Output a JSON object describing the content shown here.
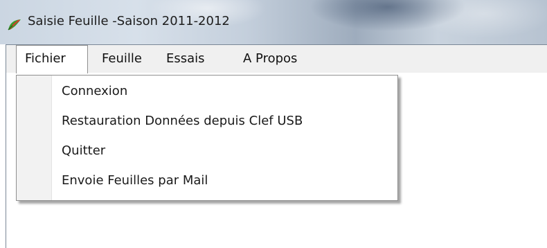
{
  "window": {
    "title": "Saisie Feuille -Saison 2011-2012",
    "icon": "app-leaf-icon"
  },
  "menubar": {
    "items": [
      {
        "label": "Fichier",
        "active": true
      },
      {
        "label": "Feuille",
        "active": false
      },
      {
        "label": "Essais",
        "active": false
      },
      {
        "label": "A Propos",
        "active": false
      }
    ]
  },
  "dropdown": {
    "items": [
      {
        "label": "Connexion"
      },
      {
        "label": "Restauration Données depuis Clef USB"
      },
      {
        "label": "Quitter"
      },
      {
        "label": "Envoie Feuilles par Mail"
      }
    ]
  }
}
